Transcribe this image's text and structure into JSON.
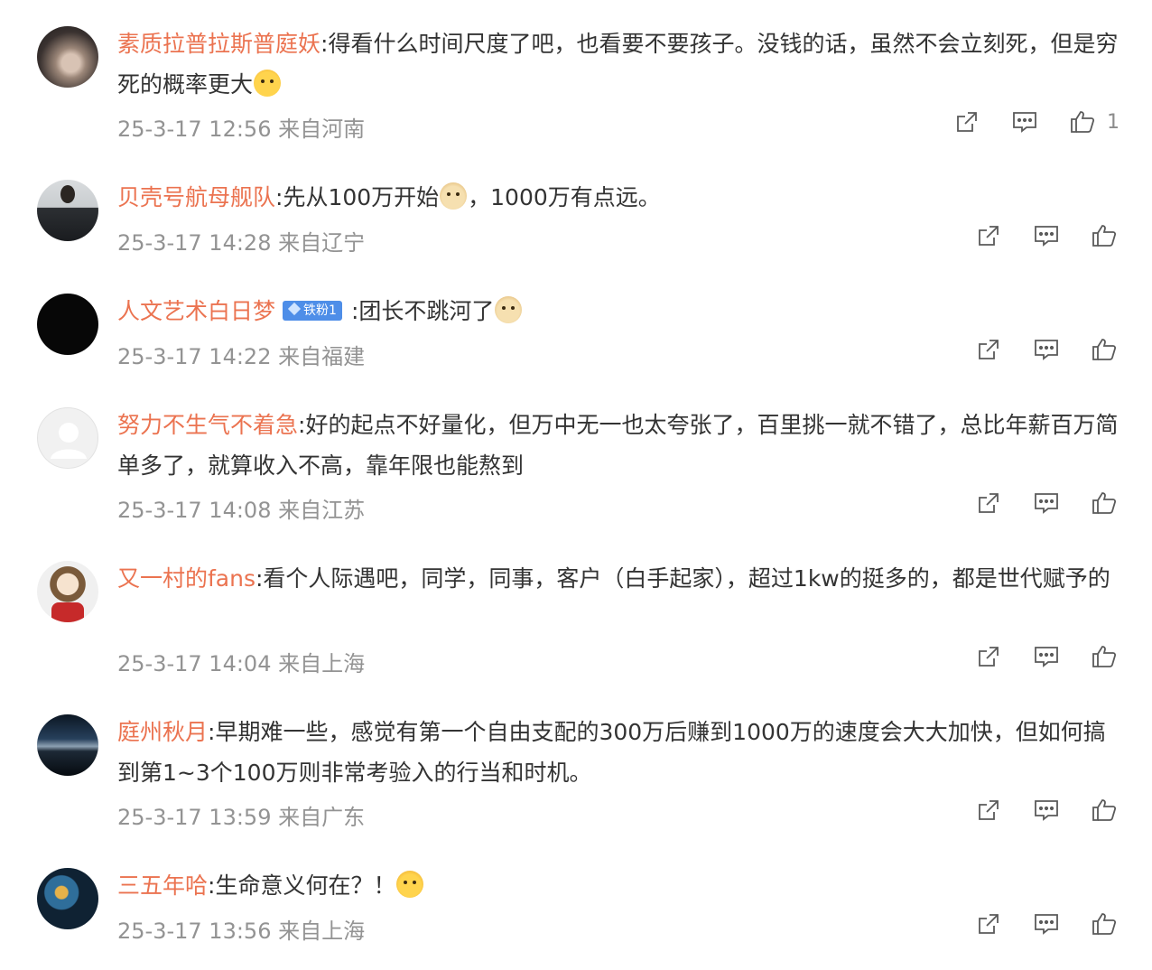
{
  "comments": [
    {
      "username": "素质拉普拉斯普庭妖",
      "text": ":得看什么时间尺度了吧，也看要不要孩子。没钱的话，虽然不会立刻死，但是穷死的概率更大",
      "text_after_emoji": "",
      "emoji": "laugh-cry-emoji",
      "badge": null,
      "time": "25-3-17 12:56",
      "location": "来自河南",
      "like_count": "1"
    },
    {
      "username": "贝壳号航母舰队",
      "text": ":先从100万开始",
      "text_after_emoji": "，1000万有点远。",
      "emoji": "doge-emoji",
      "badge": null,
      "time": "25-3-17 14:28",
      "location": "来自辽宁",
      "like_count": ""
    },
    {
      "username": "人文艺术白日梦",
      "text": ":团长不跳河了",
      "text_after_emoji": "",
      "emoji": "doge-emoji",
      "badge": "铁粉1",
      "time": "25-3-17 14:22",
      "location": "来自福建",
      "like_count": ""
    },
    {
      "username": "努力不生气不着急",
      "text": ":好的起点不好量化，但万中无一也太夸张了，百里挑一就不错了，总比年薪百万简单多了，就算收入不高，靠年限也能熬到",
      "text_after_emoji": "",
      "emoji": null,
      "badge": null,
      "time": "25-3-17 14:08",
      "location": "来自江苏",
      "like_count": ""
    },
    {
      "username": "又一村的fans",
      "text": ":看个人际遇吧，同学，同事，客户（白手起家），超过1kw的挺多的，都是世代赋予的",
      "text_after_emoji": "",
      "emoji": null,
      "badge": null,
      "time": "25-3-17 14:04",
      "location": "来自上海",
      "like_count": ""
    },
    {
      "username": "庭州秋月",
      "text": ":早期难一些，感觉有第一个自由支配的300万后赚到1000万的速度会大大加快，但如何搞到第1~3个100万则非常考验入的行当和时机。",
      "text_after_emoji": "",
      "emoji": null,
      "badge": null,
      "time": "25-3-17 13:59",
      "location": "来自广东",
      "like_count": ""
    },
    {
      "username": "三五年哈",
      "text": ":生命意义何在？！",
      "text_after_emoji": "",
      "emoji": "crying-emoji",
      "badge": null,
      "time": "25-3-17 13:56",
      "location": "来自上海",
      "like_count": ""
    }
  ],
  "icons": {
    "share": "share-icon",
    "reply": "comment-icon",
    "like": "thumbs-up-icon"
  },
  "colors": {
    "username": "#eb7350",
    "text": "#333333",
    "meta": "#939393",
    "badge": "#4e8ee8"
  }
}
